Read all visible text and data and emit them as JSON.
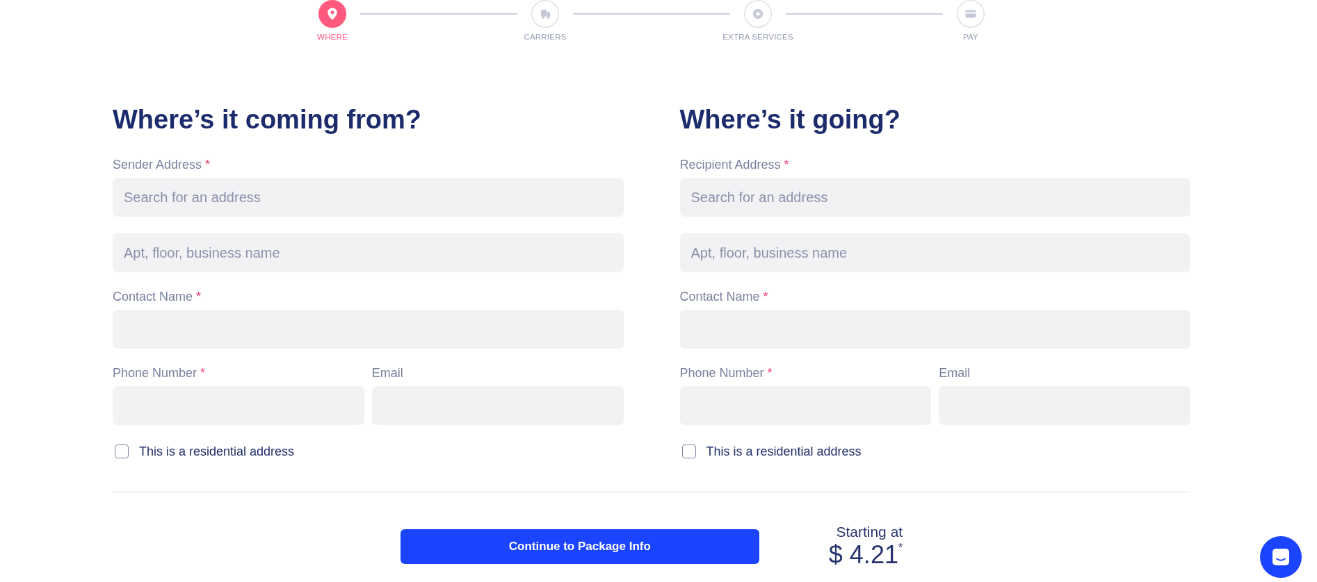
{
  "steps": [
    {
      "label": "WHERE",
      "active": true
    },
    {
      "label": "CARRIERS",
      "active": false
    },
    {
      "label": "EXTRA SERVICES",
      "active": false
    },
    {
      "label": "PAY",
      "active": false
    }
  ],
  "columns": [
    {
      "heading": "Where’s it coming from?",
      "rows": [
        [
          {
            "label": "Sender Address",
            "required_mark": "*",
            "placeholder": "Search for an address"
          }
        ],
        [
          {
            "placeholder": "Apt, floor, business name"
          }
        ],
        [
          {
            "label": "Contact Name",
            "required_mark": "*"
          }
        ],
        [
          {
            "label": "Phone Number",
            "required_mark": "*"
          },
          {
            "label": "Email"
          }
        ]
      ],
      "residential": {
        "label": "This is a residential address",
        "checked": false
      }
    },
    {
      "heading": "Where’s it going?",
      "rows": [
        [
          {
            "label": "Recipient Address",
            "required_mark": "*",
            "placeholder": "Search for an address"
          }
        ],
        [
          {
            "placeholder": "Apt, floor, business name"
          }
        ],
        [
          {
            "label": "Contact Name",
            "required_mark": "*"
          }
        ],
        [
          {
            "label": "Phone Number",
            "required_mark": "*"
          },
          {
            "label": "Email"
          }
        ]
      ],
      "residential": {
        "label": "This is a residential address",
        "checked": false
      }
    }
  ],
  "footer": {
    "button": "Continue to Package Info",
    "price_caption": "Starting at",
    "price": "$ 4.21$^{*}$"
  }
}
